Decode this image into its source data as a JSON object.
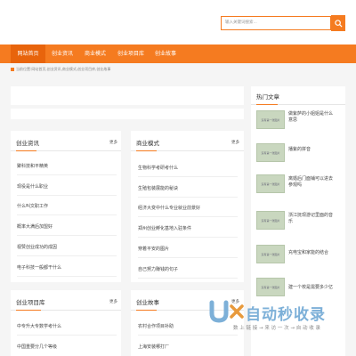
{
  "search": {
    "placeholder": "输入关键词搜索..."
  },
  "nav": {
    "items": [
      "网站首页",
      "创业资讯",
      "商业模式",
      "创业项目库",
      "创业故事"
    ]
  },
  "breadcrumb": "当前位置:网站首页,创业资讯,商业模式,创业项目库,创业故事",
  "cards": [
    {
      "title": "创业资讯",
      "more": "更多",
      "items": [
        "聚科技和平精英",
        "现役是什么职业",
        "什么叫文职工作",
        "概率大满后加盟好",
        "视赞创业成功的成因",
        "电子科技一般都干什么"
      ]
    },
    {
      "title": "商业模式",
      "more": "更多",
      "items": [
        "生物科学考研考什么",
        "生殖包装展能的秘诀",
        "经济大变中什么专业就业前景好",
        "郑州创业孵化基地入驻条件",
        "穿着平安的图片",
        "自己努力赚钱的句子"
      ]
    },
    {
      "title": "创业项目库",
      "more": "更多",
      "items": [
        "中专升大专数学考什么",
        "中国重要分几个等级"
      ]
    },
    {
      "title": "创业故事",
      "more": "更多",
      "items": [
        "农村合作项目补助",
        "上海安装哪打厂"
      ]
    }
  ],
  "hot": {
    "title": "热门文章",
    "thumb_label": "没有第一张图片",
    "items": [
      "做紫萨的小姐姐是什么意思",
      "播紫的拼音",
      "离婚后门面铺可以进去参观吗",
      "浙江抚现游记里面的音乐",
      "充电宝和家能的结合",
      "建一个校是需要多少亿"
    ]
  },
  "watermark": {
    "title": "自动秒收录",
    "subtitle": "数 上 链 接 → 来 访 一 次 → 自 动 收 录"
  }
}
